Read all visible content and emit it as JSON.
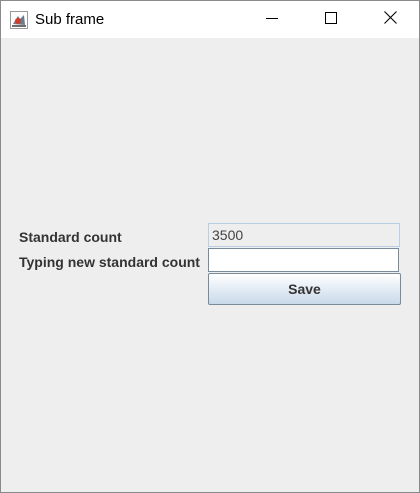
{
  "window": {
    "title": "Sub frame",
    "controls": {
      "minimize_icon": "minimize-icon",
      "maximize_icon": "maximize-icon",
      "close_icon": "close-icon"
    }
  },
  "form": {
    "standard_count_label": "Standard count",
    "standard_count_value": "3500",
    "new_count_label": "Typing new standard count",
    "new_count_value": "",
    "save_label": "Save"
  },
  "colors": {
    "window_bg": "#eeeeee",
    "titlebar_bg": "#ffffff",
    "readonly_border": "#b8cfe5",
    "button_gradient_bottom": "#c9d9ea"
  }
}
